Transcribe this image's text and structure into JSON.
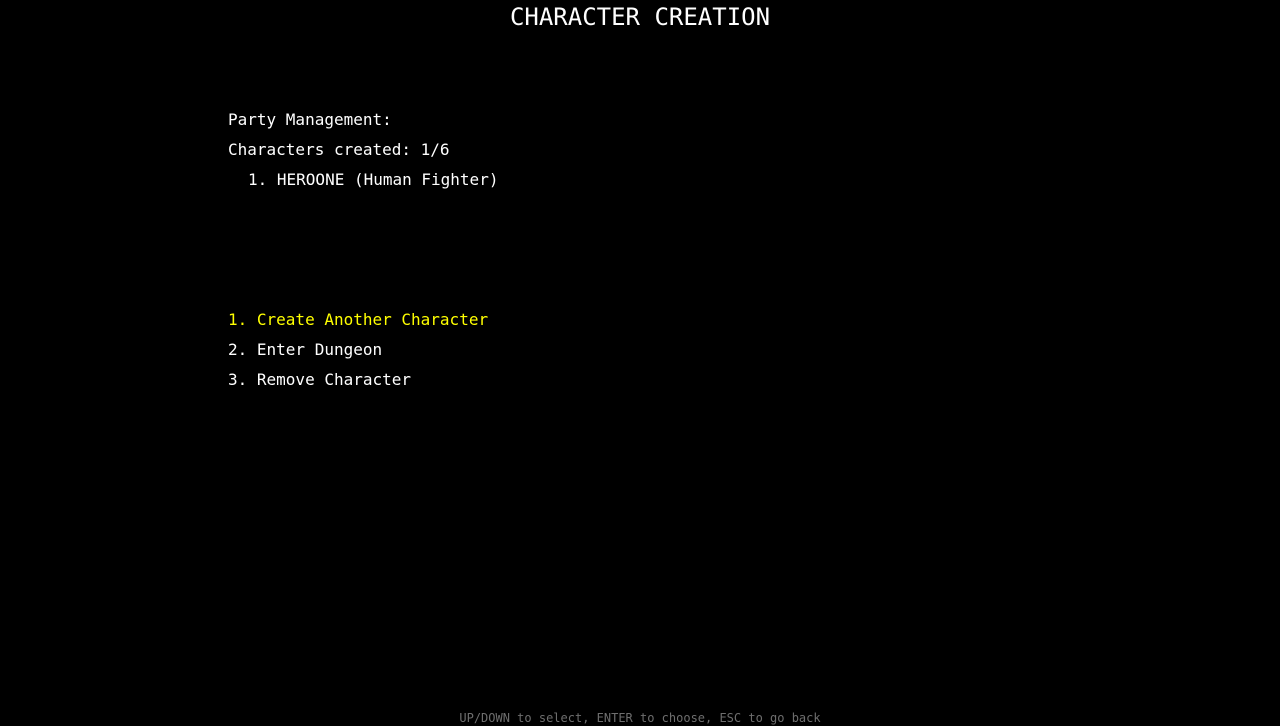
{
  "screen": {
    "title": "CHARACTER CREATION"
  },
  "party": {
    "heading": "Party Management:",
    "count_label": "Characters created: 1/6",
    "characters": [
      {
        "label": "1. HEROONE (Human Fighter)"
      }
    ]
  },
  "menu": {
    "items": [
      {
        "label": "1. Create Another Character",
        "selected": true
      },
      {
        "label": "2. Enter Dungeon",
        "selected": false
      },
      {
        "label": "3. Remove Character",
        "selected": false
      }
    ],
    "highlight_color": "#ffff00",
    "text_color": "#ffffff"
  },
  "footer": {
    "hint": "UP/DOWN to select, ENTER to choose, ESC to go back"
  }
}
